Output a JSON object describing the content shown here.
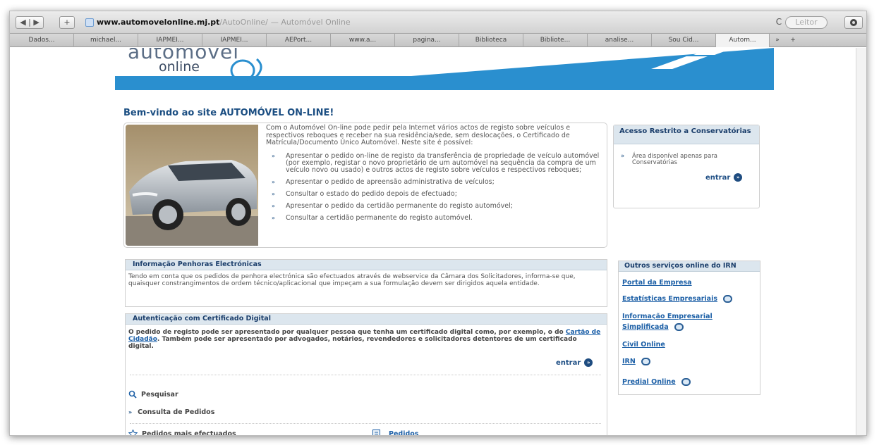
{
  "browser": {
    "url_host": "www.automovelonline.mj.pt",
    "url_path": "/AutoOnline/",
    "page_title": "— Automóvel Online",
    "reader_label": "Leitor",
    "reload_glyph": "C",
    "back_glyph": "◀ | ▶",
    "add_glyph": "+",
    "more_glyph": "»",
    "add_tab_glyph": "+"
  },
  "bookmarks": [
    "Dados...",
    "michael...",
    "IAPMEI...",
    "IAPMEI...",
    "AEPort...",
    "www.a...",
    "pagina...",
    "Biblioteca",
    "Bibliote...",
    "analise...",
    "Sou Cid...",
    "Autom..."
  ],
  "header": {
    "logo_line1": "automóvel",
    "logo_line2": "online"
  },
  "welcome_title": "Bem-vindo ao site AUTOMÓVEL ON-LINE!",
  "intro": {
    "text": "Com o Automóvel On-line pode pedir pela Internet vários actos de registo sobre veículos e respectivos reboques e receber na sua residência/sede, sem deslocações, o Certificado de Matrícula/Documento Único Automóvel. Neste site é possível:",
    "items": [
      "Apresentar o pedido on-line de registo da transferência de propriedade de veículo automóvel (por exemplo, registar o novo proprietário de um automóvel na sequência da compra de um veículo novo ou usado) e outros actos de registo sobre veículos e respectivos reboques;",
      "Apresentar o pedido de apreensão administrativa de veículos;",
      "Consultar o estado do pedido depois de efectuado;",
      "Apresentar o pedido da certidão permanente do registo automóvel;",
      "Consultar a certidão permanente do registo automóvel."
    ],
    "bullet": "»"
  },
  "access": {
    "title": "Acesso Restrito a Conservatórias",
    "note": "Área disponível apenas para Conservatórias",
    "entrar": "entrar"
  },
  "penhoras": {
    "title": "Informação Penhoras Electrónicas",
    "text": "Tendo em conta que os pedidos de penhora electrónica são efectuados através de webservice da Câmara dos Solicitadores, informa-se que, quaisquer constrangimentos de ordem técnico/aplicacional que impeçam a sua formulação devem ser dirigidos aquela entidade."
  },
  "autenticacao": {
    "title": "Autenticação com Certificado Digital",
    "text_before": "O pedido de registo pode ser apresentado por qualquer pessoa que tenha um certificado digital como, por exemplo, o do ",
    "link": "Cartão de Cidadão",
    "text_after": ". Também pode ser apresentado por advogados, notários, revendedores e solicitadores detentores de um certificado digital.",
    "entrar": "entrar",
    "pesquisar": "Pesquisar",
    "consulta": "Consulta de Pedidos",
    "mais_efectuados": "Pedidos mais efectuados",
    "pedidos": "Pedidos"
  },
  "outros": {
    "title": "Outros serviços online do IRN",
    "links": [
      "Portal da Empresa",
      "Estatísticas Empresariais",
      "Informação Empresarial",
      "Simplificada",
      "Civil Online",
      "IRN",
      "Predial Online"
    ]
  }
}
